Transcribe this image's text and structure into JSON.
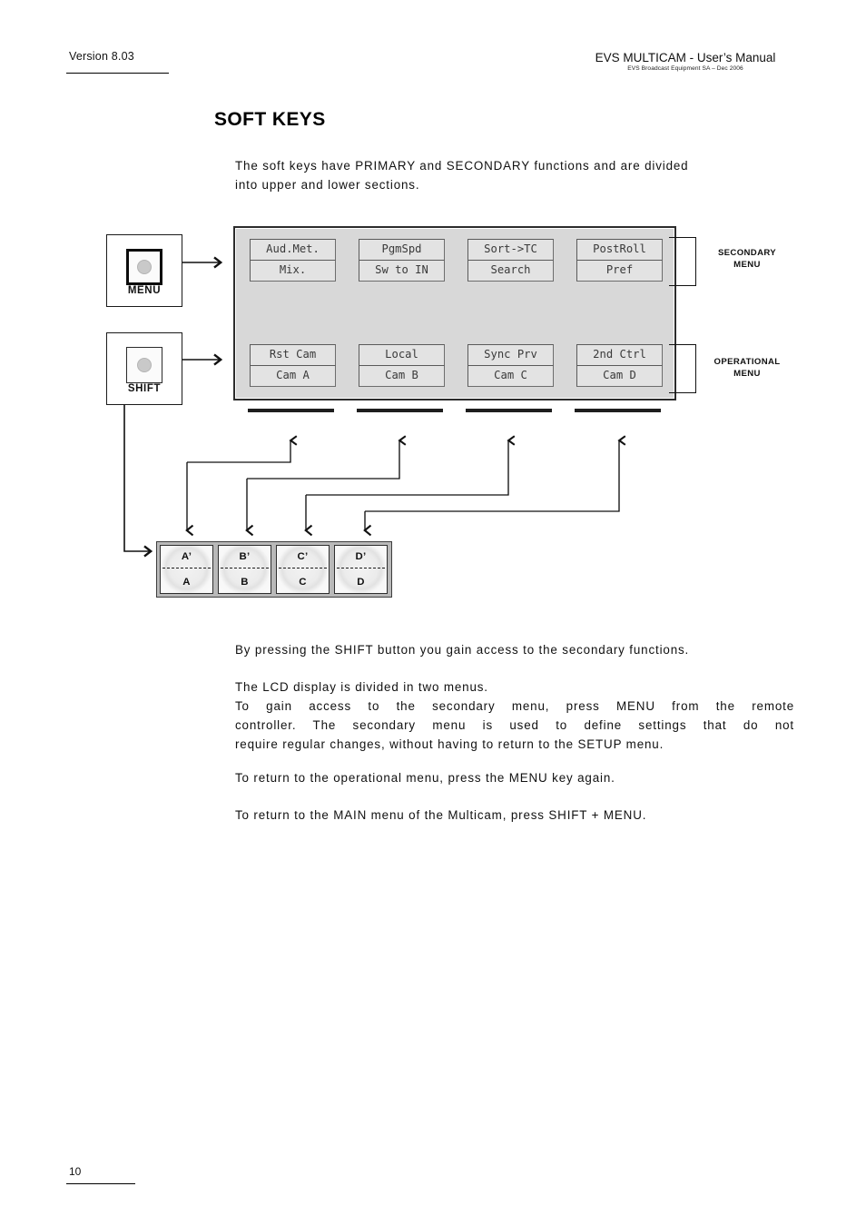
{
  "header": {
    "version": "Version 8.03",
    "title": "EVS MULTICAM  - User’s Manual",
    "subtitle": "EVS Broadcast Equipment SA – Dec 2006"
  },
  "section": {
    "title": "SOFT KEYS",
    "intro_line1": "The soft keys have PRIMARY and SECONDARY functions and are divided",
    "intro_line2": "into upper and lower sections."
  },
  "diagram": {
    "remote_buttons": [
      {
        "name": "MENU",
        "label": "MENU"
      },
      {
        "name": "SHIFT",
        "label": "SHIFT"
      }
    ],
    "bracket_labels": {
      "secondary_line1": "SECONDARY",
      "secondary_line2": "MENU",
      "operational_line1": "OPERATIONAL",
      "operational_line2": "MENU"
    },
    "lcd": {
      "secondary_row": [
        {
          "upper": "Aud.Met.",
          "lower": "Mix."
        },
        {
          "upper": "PgmSpd",
          "lower": "Sw to IN"
        },
        {
          "upper": "Sort->TC",
          "lower": "Search"
        },
        {
          "upper": "PostRoll",
          "lower": "Pref"
        }
      ],
      "operational_row": [
        {
          "upper": "Rst Cam",
          "lower": "Cam A"
        },
        {
          "upper": "Local",
          "lower": "Cam B"
        },
        {
          "upper": "Sync Prv",
          "lower": "Cam C"
        },
        {
          "upper": "2nd Ctrl",
          "lower": "Cam D"
        }
      ]
    },
    "soft_keys": [
      {
        "upper": "A’",
        "lower": "A"
      },
      {
        "upper": "B’",
        "lower": "B"
      },
      {
        "upper": "C’",
        "lower": "C"
      },
      {
        "upper": "D’",
        "lower": "D"
      }
    ]
  },
  "body": {
    "p1": "By pressing the SHIFT button you gain access to the secondary functions.",
    "p2_line1": "The LCD display is divided in two menus.",
    "p2_line2": "To gain access to the secondary menu, press MENU from the remote",
    "p2_line3": "controller. The secondary menu is used to define settings that do not",
    "p2_line4": "require regular changes, without having to return to the SETUP menu.",
    "p3": "To return to the operational menu, press the MENU key again.",
    "p4": "To return to the MAIN menu of the Multicam, press SHIFT + MENU."
  },
  "footer": {
    "page_number": "10"
  },
  "colors": {
    "lcd_background": "#d8d8d8",
    "lcd_cell": "#e3e3e3",
    "lcd_text": "#3a3a3a",
    "ink": "#111111",
    "bar": "#1e1e1e"
  }
}
